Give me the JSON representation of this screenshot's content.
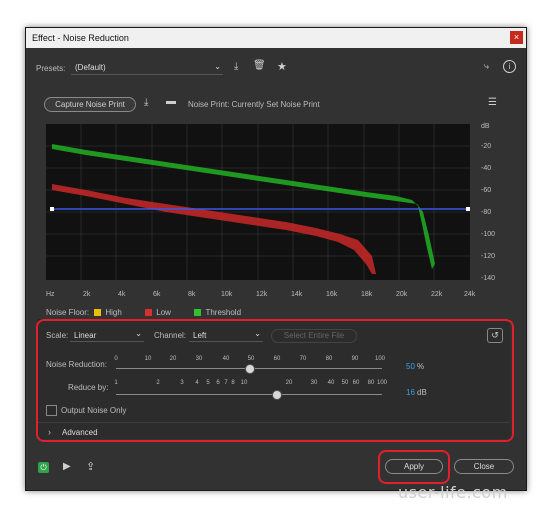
{
  "window": {
    "title": "Effect - Noise Reduction",
    "close_glyph": "×"
  },
  "presets": {
    "label": "Presets:",
    "value": "(Default)"
  },
  "capture": {
    "button": "Capture Noise Print",
    "status": "Noise Print: Currently Set Noise Print"
  },
  "graph": {
    "y_unit": "dB",
    "y_ticks": [
      "-20",
      "-40",
      "-60",
      "-80",
      "-100",
      "-120",
      "-140"
    ],
    "x_ticks": [
      "Hz",
      "2k",
      "4k",
      "6k",
      "8k",
      "10k",
      "12k",
      "14k",
      "16k",
      "18k",
      "20k",
      "22k",
      "24k"
    ],
    "legend_title": "Noise Floor:",
    "legend": [
      {
        "label": "High",
        "color": "#e8c000"
      },
      {
        "label": "Low",
        "color": "#d83030"
      },
      {
        "label": "Threshold",
        "color": "#30c030"
      }
    ]
  },
  "controls": {
    "scale_label": "Scale:",
    "scale_value": "Linear",
    "channel_label": "Channel:",
    "channel_value": "Left",
    "select_entire": "Select Entire File",
    "noise_reduction_label": "Noise Reduction:",
    "noise_reduction_ticks": [
      "0",
      "10",
      "20",
      "30",
      "40",
      "50",
      "60",
      "70",
      "80",
      "90",
      "100"
    ],
    "noise_reduction_value": "50",
    "noise_reduction_unit": "%",
    "reduce_by_label": "Reduce by:",
    "reduce_by_ticks": [
      "1",
      "2",
      "3",
      "4",
      "5",
      "6",
      "7",
      "8",
      "10",
      "20",
      "30",
      "40",
      "50",
      "60",
      "80",
      "100"
    ],
    "reduce_by_value": "16",
    "reduce_by_unit": "dB",
    "output_noise_only": "Output Noise Only",
    "advanced": "Advanced",
    "advanced_chevron": "›"
  },
  "footer": {
    "apply": "Apply",
    "close": "Close"
  },
  "watermark": "user-life.com"
}
